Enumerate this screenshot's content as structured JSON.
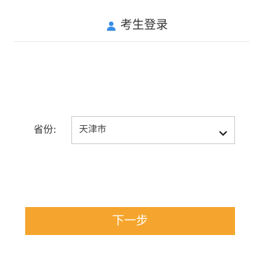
{
  "header": {
    "title": "考生登录",
    "icon": "user-icon"
  },
  "form": {
    "province_label": "省份:",
    "province_value": "天津市",
    "dropdown_icon": "chevron-down-icon"
  },
  "actions": {
    "next_label": "下一步"
  },
  "colors": {
    "accent": "#f5a52d",
    "icon_blue": "#3a8ee6",
    "divider": "#e8e8e8",
    "border": "#cccccc"
  }
}
